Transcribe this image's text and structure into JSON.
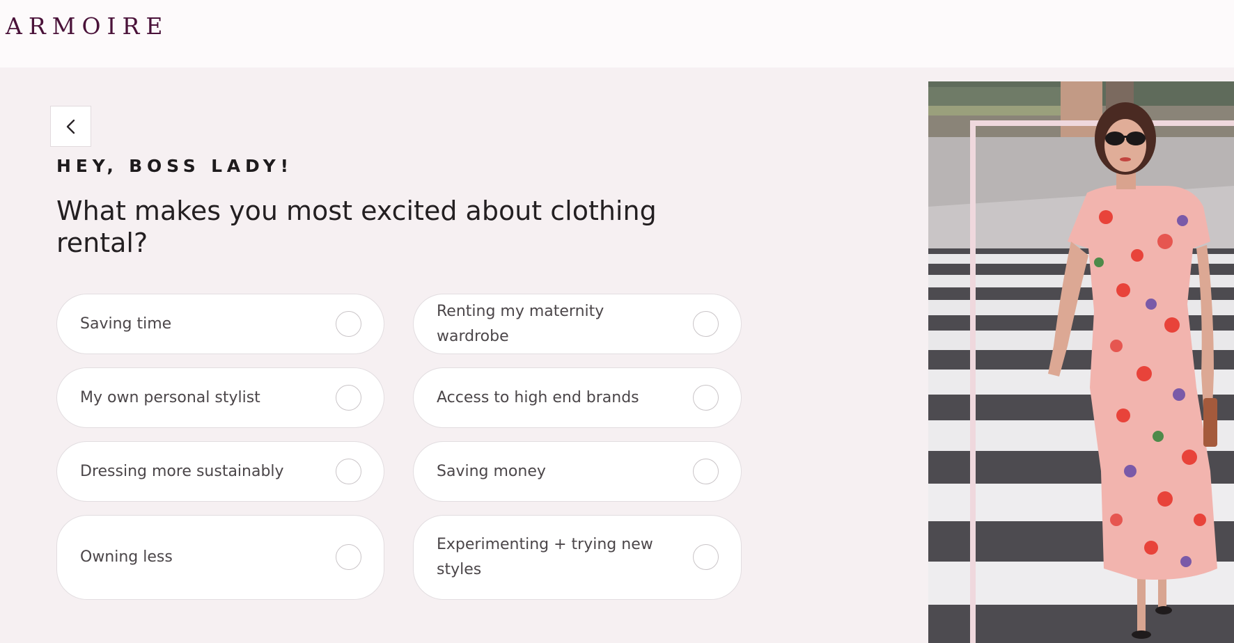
{
  "brand": {
    "logo_text": "ARMOIRE",
    "logo_color": "#4a1239"
  },
  "colors": {
    "page_background": "#f6f0f2",
    "header_background": "#fdfafb",
    "option_border": "#e2dde0",
    "text_dark": "#231f21"
  },
  "nav": {
    "back_icon": "chevron-left-icon"
  },
  "quiz": {
    "eyebrow": "HEY, BOSS LADY!",
    "question": "What makes you most excited about clothing rental?",
    "options": [
      {
        "label": "Saving time",
        "selected": false
      },
      {
        "label": "Renting my maternity wardrobe",
        "selected": false
      },
      {
        "label": "My own personal stylist",
        "selected": false
      },
      {
        "label": "Access to high end brands",
        "selected": false
      },
      {
        "label": "Dressing more sustainably",
        "selected": false
      },
      {
        "label": "Saving money",
        "selected": false
      },
      {
        "label": "Owning less",
        "selected": false
      },
      {
        "label": "Experimenting + trying new styles",
        "selected": false
      }
    ]
  },
  "hero_image": {
    "subject": "woman in pink floral dress and sunglasses walking across a crosswalk"
  }
}
